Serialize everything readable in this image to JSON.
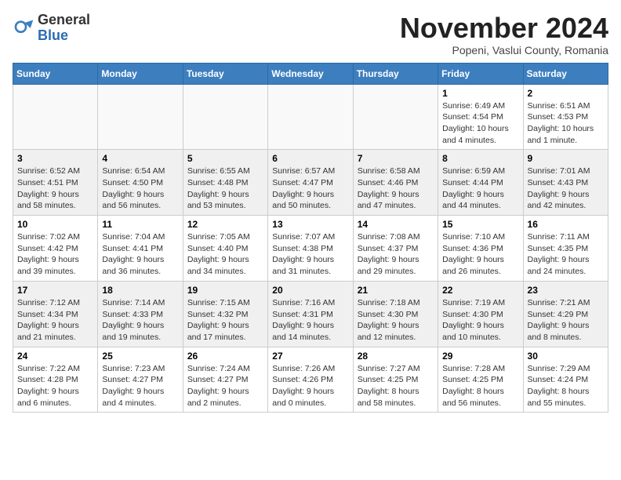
{
  "header": {
    "logo_general": "General",
    "logo_blue": "Blue",
    "month_title": "November 2024",
    "subtitle": "Popeni, Vaslui County, Romania"
  },
  "weekdays": [
    "Sunday",
    "Monday",
    "Tuesday",
    "Wednesday",
    "Thursday",
    "Friday",
    "Saturday"
  ],
  "weeks": [
    [
      {
        "day": "",
        "info": ""
      },
      {
        "day": "",
        "info": ""
      },
      {
        "day": "",
        "info": ""
      },
      {
        "day": "",
        "info": ""
      },
      {
        "day": "",
        "info": ""
      },
      {
        "day": "1",
        "info": "Sunrise: 6:49 AM\nSunset: 4:54 PM\nDaylight: 10 hours and 4 minutes."
      },
      {
        "day": "2",
        "info": "Sunrise: 6:51 AM\nSunset: 4:53 PM\nDaylight: 10 hours and 1 minute."
      }
    ],
    [
      {
        "day": "3",
        "info": "Sunrise: 6:52 AM\nSunset: 4:51 PM\nDaylight: 9 hours and 58 minutes."
      },
      {
        "day": "4",
        "info": "Sunrise: 6:54 AM\nSunset: 4:50 PM\nDaylight: 9 hours and 56 minutes."
      },
      {
        "day": "5",
        "info": "Sunrise: 6:55 AM\nSunset: 4:48 PM\nDaylight: 9 hours and 53 minutes."
      },
      {
        "day": "6",
        "info": "Sunrise: 6:57 AM\nSunset: 4:47 PM\nDaylight: 9 hours and 50 minutes."
      },
      {
        "day": "7",
        "info": "Sunrise: 6:58 AM\nSunset: 4:46 PM\nDaylight: 9 hours and 47 minutes."
      },
      {
        "day": "8",
        "info": "Sunrise: 6:59 AM\nSunset: 4:44 PM\nDaylight: 9 hours and 44 minutes."
      },
      {
        "day": "9",
        "info": "Sunrise: 7:01 AM\nSunset: 4:43 PM\nDaylight: 9 hours and 42 minutes."
      }
    ],
    [
      {
        "day": "10",
        "info": "Sunrise: 7:02 AM\nSunset: 4:42 PM\nDaylight: 9 hours and 39 minutes."
      },
      {
        "day": "11",
        "info": "Sunrise: 7:04 AM\nSunset: 4:41 PM\nDaylight: 9 hours and 36 minutes."
      },
      {
        "day": "12",
        "info": "Sunrise: 7:05 AM\nSunset: 4:40 PM\nDaylight: 9 hours and 34 minutes."
      },
      {
        "day": "13",
        "info": "Sunrise: 7:07 AM\nSunset: 4:38 PM\nDaylight: 9 hours and 31 minutes."
      },
      {
        "day": "14",
        "info": "Sunrise: 7:08 AM\nSunset: 4:37 PM\nDaylight: 9 hours and 29 minutes."
      },
      {
        "day": "15",
        "info": "Sunrise: 7:10 AM\nSunset: 4:36 PM\nDaylight: 9 hours and 26 minutes."
      },
      {
        "day": "16",
        "info": "Sunrise: 7:11 AM\nSunset: 4:35 PM\nDaylight: 9 hours and 24 minutes."
      }
    ],
    [
      {
        "day": "17",
        "info": "Sunrise: 7:12 AM\nSunset: 4:34 PM\nDaylight: 9 hours and 21 minutes."
      },
      {
        "day": "18",
        "info": "Sunrise: 7:14 AM\nSunset: 4:33 PM\nDaylight: 9 hours and 19 minutes."
      },
      {
        "day": "19",
        "info": "Sunrise: 7:15 AM\nSunset: 4:32 PM\nDaylight: 9 hours and 17 minutes."
      },
      {
        "day": "20",
        "info": "Sunrise: 7:16 AM\nSunset: 4:31 PM\nDaylight: 9 hours and 14 minutes."
      },
      {
        "day": "21",
        "info": "Sunrise: 7:18 AM\nSunset: 4:30 PM\nDaylight: 9 hours and 12 minutes."
      },
      {
        "day": "22",
        "info": "Sunrise: 7:19 AM\nSunset: 4:30 PM\nDaylight: 9 hours and 10 minutes."
      },
      {
        "day": "23",
        "info": "Sunrise: 7:21 AM\nSunset: 4:29 PM\nDaylight: 9 hours and 8 minutes."
      }
    ],
    [
      {
        "day": "24",
        "info": "Sunrise: 7:22 AM\nSunset: 4:28 PM\nDaylight: 9 hours and 6 minutes."
      },
      {
        "day": "25",
        "info": "Sunrise: 7:23 AM\nSunset: 4:27 PM\nDaylight: 9 hours and 4 minutes."
      },
      {
        "day": "26",
        "info": "Sunrise: 7:24 AM\nSunset: 4:27 PM\nDaylight: 9 hours and 2 minutes."
      },
      {
        "day": "27",
        "info": "Sunrise: 7:26 AM\nSunset: 4:26 PM\nDaylight: 9 hours and 0 minutes."
      },
      {
        "day": "28",
        "info": "Sunrise: 7:27 AM\nSunset: 4:25 PM\nDaylight: 8 hours and 58 minutes."
      },
      {
        "day": "29",
        "info": "Sunrise: 7:28 AM\nSunset: 4:25 PM\nDaylight: 8 hours and 56 minutes."
      },
      {
        "day": "30",
        "info": "Sunrise: 7:29 AM\nSunset: 4:24 PM\nDaylight: 8 hours and 55 minutes."
      }
    ]
  ]
}
